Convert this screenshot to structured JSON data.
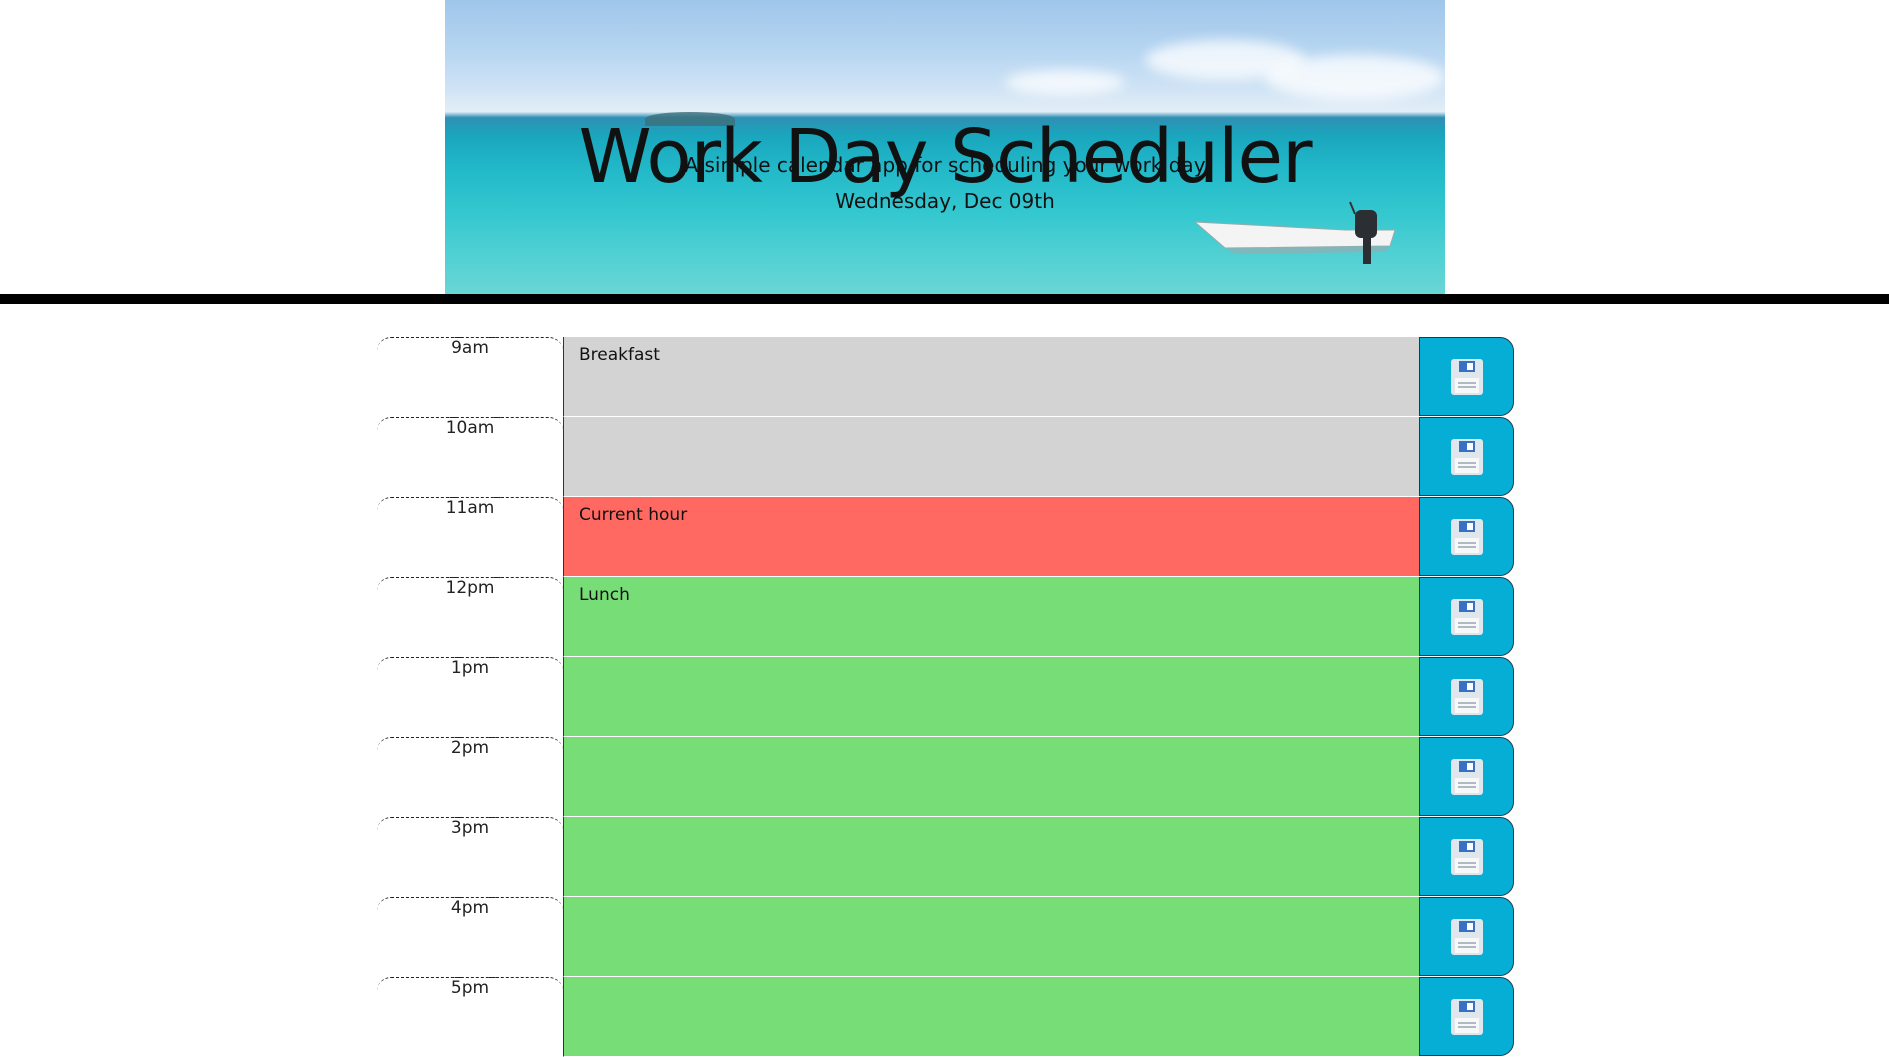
{
  "header": {
    "title": "Work Day Scheduler",
    "subtitle": "A simple calendar app for scheduling your work day",
    "current_day": "Wednesday, Dec 09th"
  },
  "colors": {
    "past": "#d3d3d3",
    "present": "#ff6961",
    "future": "#77dd77",
    "save_button": "#06aed5"
  },
  "time_blocks": [
    {
      "hour": "9am",
      "text": "Breakfast",
      "state": "past",
      "save_icon": "save-icon"
    },
    {
      "hour": "10am",
      "text": "",
      "state": "past",
      "save_icon": "save-icon"
    },
    {
      "hour": "11am",
      "text": "Current hour",
      "state": "present",
      "save_icon": "save-icon"
    },
    {
      "hour": "12pm",
      "text": "Lunch",
      "state": "future",
      "save_icon": "save-icon"
    },
    {
      "hour": "1pm",
      "text": "",
      "state": "future",
      "save_icon": "save-icon"
    },
    {
      "hour": "2pm",
      "text": "",
      "state": "future",
      "save_icon": "save-icon"
    },
    {
      "hour": "3pm",
      "text": "",
      "state": "future",
      "save_icon": "save-icon"
    },
    {
      "hour": "4pm",
      "text": "",
      "state": "future",
      "save_icon": "save-icon"
    },
    {
      "hour": "5pm",
      "text": "",
      "state": "future",
      "save_icon": "save-icon"
    }
  ]
}
